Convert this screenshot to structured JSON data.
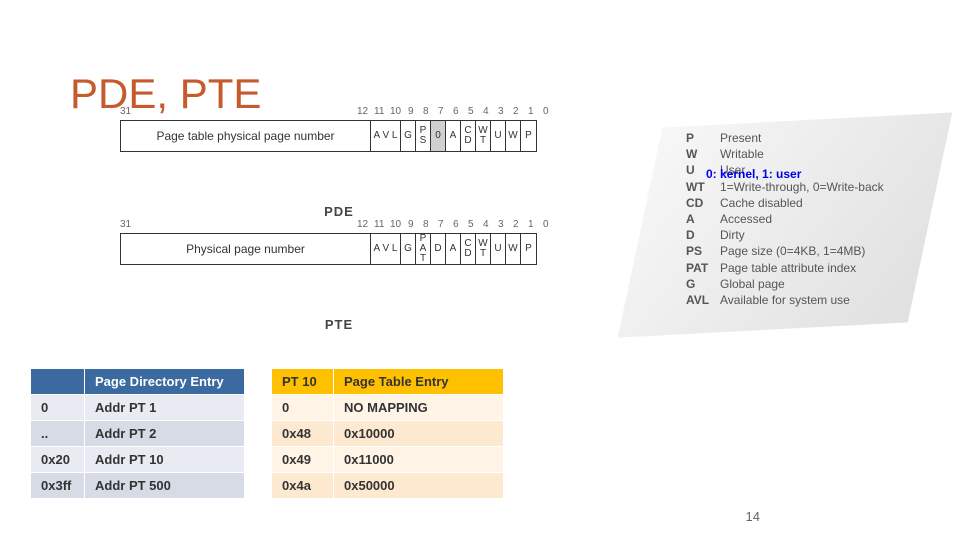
{
  "title": "PDE, PTE",
  "annotation": "0: kernel, 1: user",
  "page_number": "14",
  "pde_diagram": {
    "label": "PDE",
    "bits_top": {
      "b31": "31",
      "b12": "12",
      "b11": "11",
      "b10": "10",
      "b9": "9",
      "b8": "8",
      "b7": "7",
      "b6": "6",
      "b5": "5",
      "b4": "4",
      "b3": "3",
      "b2": "2",
      "b1": "1",
      "b0": "0"
    },
    "fields": {
      "ppn": "Page table physical page number",
      "avl": "A\nV\nL",
      "g": "G",
      "ps": "P\nS",
      "zero": "0",
      "a": "A",
      "cd": "C\nD",
      "wt": "W\nT",
      "u": "U",
      "w": "W",
      "p": "P"
    }
  },
  "pte_diagram": {
    "label": "PTE",
    "bits_top": {
      "b31": "31",
      "b12": "12",
      "b11": "11",
      "b10": "10",
      "b9": "9",
      "b8": "8",
      "b7": "7",
      "b6": "6",
      "b5": "5",
      "b4": "4",
      "b3": "3",
      "b2": "2",
      "b1": "1",
      "b0": "0"
    },
    "fields": {
      "ppn": "Physical page number",
      "avl": "A\nV\nL",
      "g": "G",
      "pat": "P\nA\nT",
      "d": "D",
      "a": "A",
      "cd": "C\nD",
      "wt": "W\nT",
      "u": "U",
      "w": "W",
      "p": "P"
    }
  },
  "flag_legend": [
    {
      "k": "P",
      "v": "Present"
    },
    {
      "k": "W",
      "v": "Writable"
    },
    {
      "k": "U",
      "v": "User"
    },
    {
      "k": "WT",
      "v": "1=Write-through, 0=Write-back"
    },
    {
      "k": "CD",
      "v": "Cache disabled"
    },
    {
      "k": "A",
      "v": "Accessed"
    },
    {
      "k": "D",
      "v": "Dirty"
    },
    {
      "k": "PS",
      "v": "Page size (0=4KB, 1=4MB)"
    },
    {
      "k": "PAT",
      "v": "Page table attribute index"
    },
    {
      "k": "G",
      "v": "Global page"
    },
    {
      "k": "AVL",
      "v": "Available for system use"
    }
  ],
  "pde_table": {
    "headers": [
      "",
      "Page Directory Entry"
    ],
    "rows": [
      [
        "0",
        "Addr PT 1"
      ],
      [
        "..",
        "Addr PT 2"
      ],
      [
        "0x20",
        "Addr PT 10"
      ],
      [
        "0x3ff",
        "Addr PT 500"
      ]
    ]
  },
  "pte_table": {
    "headers": [
      "PT 10",
      "Page Table Entry"
    ],
    "rows": [
      [
        "0",
        "NO MAPPING"
      ],
      [
        "0x48",
        "0x10000"
      ],
      [
        "0x49",
        "0x11000"
      ],
      [
        "0x4a",
        "0x50000"
      ]
    ]
  }
}
